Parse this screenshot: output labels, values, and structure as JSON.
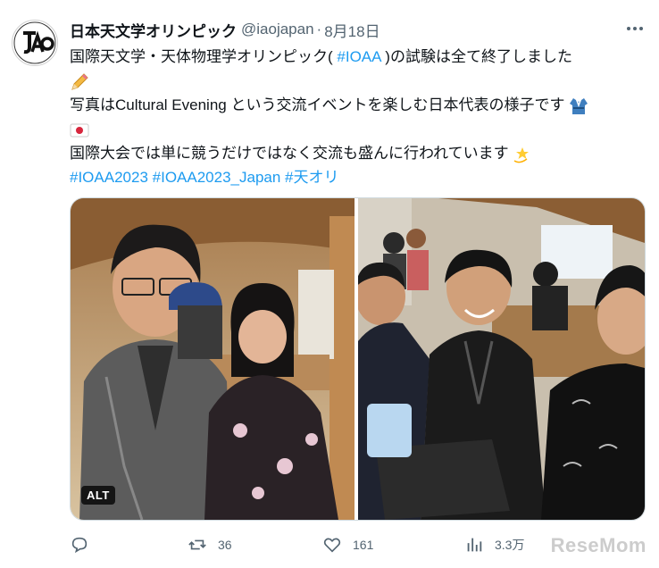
{
  "tweet": {
    "display_name": "日本天文学オリンピック",
    "handle": "@iaojapan",
    "separator": "·",
    "date": "8月18日",
    "lines": {
      "l1_pre": "国際天文学・天体物理学オリンピック(",
      "l1_link": "#IOAA",
      "l1_post": ")の試験は全て終了しました",
      "l2": "写真はCultural Evening という交流イベントを楽しむ日本代表の様子です",
      "l3": "国際大会では単に競うだけではなく交流も盛んに行われています",
      "hashtags": [
        "#IOAA2023",
        "#IOAA2023_Japan",
        "#天オリ"
      ]
    },
    "media": {
      "alt_label": "ALT"
    },
    "actions": {
      "reply": "",
      "retweets": "36",
      "likes": "161",
      "views": "3.3万"
    }
  },
  "watermark": "ReseMom",
  "colors": {
    "link": "#1d9bf0",
    "muted": "#536471",
    "text": "#0f1419"
  },
  "icons": [
    "more-icon",
    "pencil-emoji",
    "kimono-emoji",
    "japan-flag-emoji",
    "dizzy-star-emoji",
    "reply-icon",
    "retweet-icon",
    "like-icon",
    "views-icon"
  ]
}
